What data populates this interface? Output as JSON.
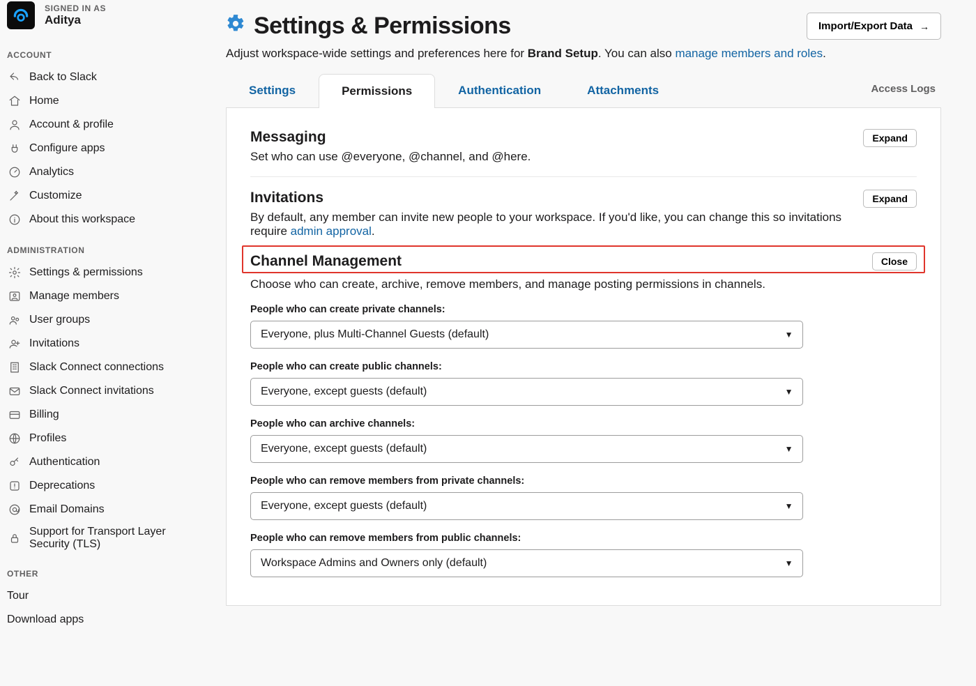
{
  "user": {
    "signed_in_label": "SIGNED IN AS",
    "name": "Aditya"
  },
  "sidebar": {
    "account_label": "ACCOUNT",
    "admin_label": "ADMINISTRATION",
    "other_label": "OTHER",
    "account_items": [
      {
        "icon": "back-icon",
        "label": "Back to Slack"
      },
      {
        "icon": "home-icon",
        "label": "Home"
      },
      {
        "icon": "person-icon",
        "label": "Account & profile"
      },
      {
        "icon": "plug-icon",
        "label": "Configure apps"
      },
      {
        "icon": "gauge-icon",
        "label": "Analytics"
      },
      {
        "icon": "wand-icon",
        "label": "Customize"
      },
      {
        "icon": "info-icon",
        "label": "About this workspace"
      }
    ],
    "admin_items": [
      {
        "icon": "gear-icon",
        "label": "Settings & permissions"
      },
      {
        "icon": "members-icon",
        "label": "Manage members"
      },
      {
        "icon": "group-icon",
        "label": "User groups"
      },
      {
        "icon": "invite-icon",
        "label": "Invitations"
      },
      {
        "icon": "building-icon",
        "label": "Slack Connect connections"
      },
      {
        "icon": "envelope-icon",
        "label": "Slack Connect invitations"
      },
      {
        "icon": "card-icon",
        "label": "Billing"
      },
      {
        "icon": "globe-icon",
        "label": "Profiles"
      },
      {
        "icon": "key-icon",
        "label": "Authentication"
      },
      {
        "icon": "warn-icon",
        "label": "Deprecations"
      },
      {
        "icon": "at-icon",
        "label": "Email Domains"
      },
      {
        "icon": "lock-icon",
        "label": "Support for Transport Layer Security (TLS)"
      }
    ],
    "other_items": [
      {
        "label": "Tour"
      },
      {
        "label": "Download apps"
      }
    ]
  },
  "header": {
    "title": "Settings & Permissions",
    "import_btn": "Import/Export Data",
    "subtitle_pre": "Adjust workspace-wide settings and preferences here for ",
    "workspace_name": "Brand Setup",
    "subtitle_mid": ". You can also ",
    "manage_link": "manage members and roles",
    "subtitle_end": "."
  },
  "tabs": {
    "settings": "Settings",
    "permissions": "Permissions",
    "authentication": "Authentication",
    "attachments": "Attachments",
    "access_logs": "Access Logs"
  },
  "buttons": {
    "expand": "Expand",
    "close": "Close"
  },
  "sections": {
    "messaging": {
      "title": "Messaging",
      "desc": "Set who can use @everyone, @channel, and @here."
    },
    "invitations": {
      "title": "Invitations",
      "desc_pre": "By default, any member can invite new people to your workspace. If you'd like, you can change this so invitations require ",
      "link": "admin approval",
      "desc_post": "."
    },
    "channel_mgmt": {
      "title": "Channel Management",
      "desc": "Choose who can create, archive, remove members, and manage posting permissions in channels.",
      "fields": [
        {
          "label": "People who can create private channels:",
          "value": "Everyone, plus Multi-Channel Guests (default)"
        },
        {
          "label": "People who can create public channels:",
          "value": "Everyone, except guests (default)"
        },
        {
          "label": "People who can archive channels:",
          "value": "Everyone, except guests (default)"
        },
        {
          "label": "People who can remove members from private channels:",
          "value": "Everyone, except guests (default)"
        },
        {
          "label": "People who can remove members from public channels:",
          "value": "Workspace Admins and Owners only (default)"
        }
      ]
    }
  }
}
